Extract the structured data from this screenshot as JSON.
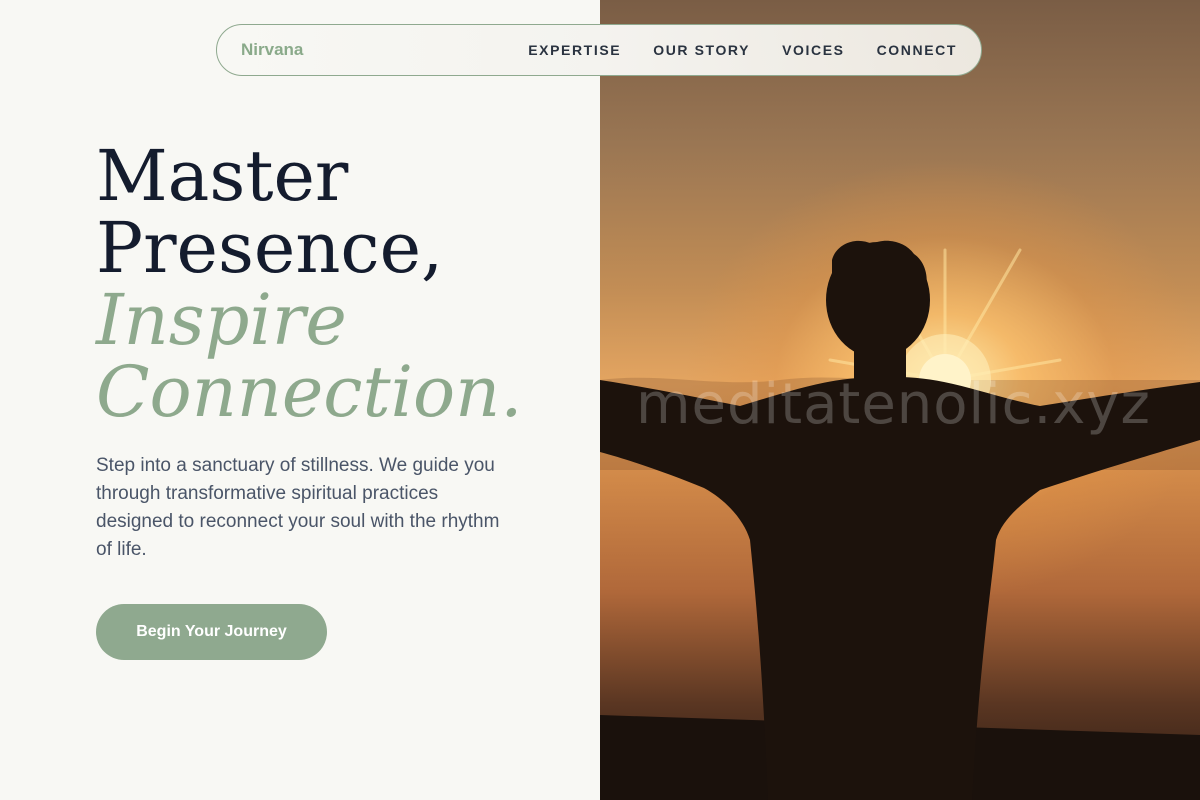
{
  "nav": {
    "brand": "Nirvana",
    "links": [
      "EXPERTISE",
      "OUR STORY",
      "VOICES",
      "CONNECT"
    ]
  },
  "hero": {
    "line1": "Master",
    "line2": "Presence,",
    "line3": "Inspire",
    "line4": "Connection.",
    "description": "Step into a sanctuary of stillness. We guide you through transformative spiritual practices designed to reconnect your soul with the rhythm of life.",
    "cta_label": "Begin Your Journey"
  },
  "image": {
    "watermark": "meditatenolic.xyz",
    "subject": "silhouette-with-arms-outstretched-at-sunset"
  },
  "colors": {
    "accent": "#8fa98f",
    "heading": "#141c2e",
    "body": "#4a5568",
    "background": "#f8f8f4"
  }
}
